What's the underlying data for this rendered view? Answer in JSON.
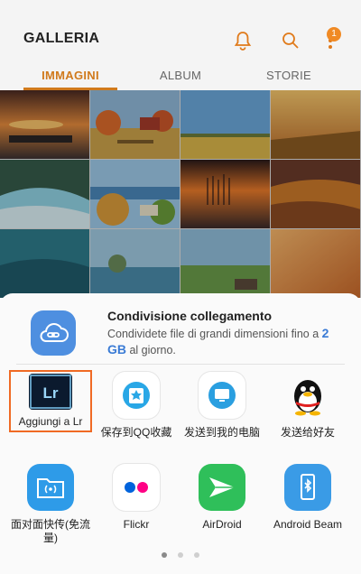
{
  "header": {
    "title": "GALLERIA",
    "notification_badge": "1"
  },
  "tabs": [
    {
      "label": "IMMAGINI",
      "active": true
    },
    {
      "label": "ALBUM",
      "active": false
    },
    {
      "label": "STORIE",
      "active": false
    }
  ],
  "share_sheet": {
    "link_sharing": {
      "title": "Condivisione collegamento",
      "description": "Condividete file di grandi dimensioni fino a",
      "size": "2 GB",
      "description_end": "al giorno."
    },
    "apps": [
      {
        "label": "Aggiungi a Lr",
        "icon": "lightroom-icon"
      },
      {
        "label": "保存到QQ收藏",
        "icon": "qq-favorites-icon"
      },
      {
        "label": "发送到我的电脑",
        "icon": "send-to-pc-icon"
      },
      {
        "label": "发送给好友",
        "icon": "qq-penguin-icon"
      },
      {
        "label": "面对面快传(免流量)",
        "icon": "face-to-face-transfer-icon"
      },
      {
        "label": "Flickr",
        "icon": "flickr-icon"
      },
      {
        "label": "AirDroid",
        "icon": "airdroid-icon"
      },
      {
        "label": "Android Beam",
        "icon": "android-beam-icon"
      }
    ],
    "page_indicator": {
      "pages": 3,
      "current": 1
    }
  },
  "colors": {
    "accent": "#d07a1c",
    "badge": "#f08a24",
    "link_blue": "#3a7bd5",
    "highlight": "#f06a24"
  }
}
